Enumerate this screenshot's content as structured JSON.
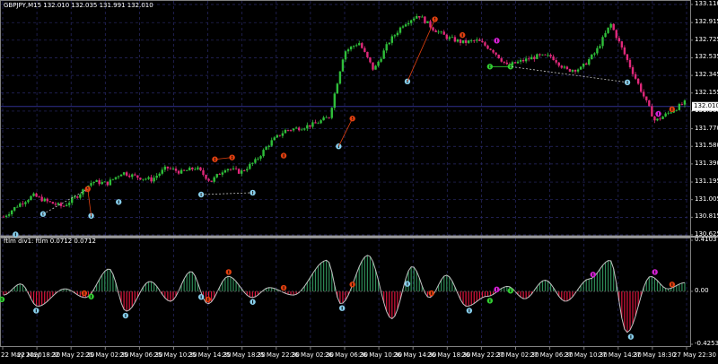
{
  "window": {
    "title": "GBPJPY,M15  132.010 132.035 131.991 132.010",
    "indicator_title": "ftlm div1: ftlm 0.0712 0.0712"
  },
  "colors": {
    "background": "#000000",
    "grid": "#2a2a6a",
    "candle_up": "#2fbf3a",
    "candle_down": "#e0287a",
    "candle_neutral": "#a0a0a0",
    "hist_up": "#2e8b57",
    "hist_down": "#dc143c",
    "osc_line": "#c0c0c0",
    "bid_line": "#303090",
    "arrow_down": "#e04010",
    "arrow_down_strong": "#d020d0",
    "arrow_up": "#87ceeb",
    "arrow_up_strong": "#32cd32",
    "div_line_bear": "#e04010",
    "div_line_bull": "#32cd32",
    "div_line_hidden": "#c0c0c0"
  },
  "chart_data": [
    {
      "type": "candlestick",
      "title": "GBPJPY,M15  132.010 132.035 131.991 132.010",
      "symbol": "GBPJPY",
      "timeframe": "M15",
      "last_price_label": "132.010",
      "ylim": [
        130.625,
        133.11
      ],
      "y_ticks": [
        "133.110",
        "132.915",
        "132.725",
        "132.535",
        "132.345",
        "132.155",
        "131.960",
        "131.770",
        "131.580",
        "131.390",
        "131.195",
        "131.005",
        "130.815",
        "130.625"
      ],
      "close_path": [
        130.82,
        130.95,
        131.05,
        130.98,
        130.93,
        131.05,
        131.2,
        131.18,
        131.3,
        131.25,
        131.22,
        131.35,
        131.3,
        131.35,
        131.2,
        131.35,
        131.3,
        131.42,
        131.62,
        131.75,
        131.78,
        131.82,
        131.9,
        132.6,
        132.7,
        132.4,
        132.7,
        132.9,
        133.0,
        132.85,
        132.75,
        132.7,
        132.72,
        132.62,
        132.45,
        132.5,
        132.55,
        132.55,
        132.4,
        132.42,
        132.6,
        132.9,
        132.55,
        132.2,
        131.85,
        131.95,
        132.05
      ],
      "price_cursor_level": 132.01,
      "signals": [
        {
          "kind": "up",
          "i": 0.02,
          "price": 130.63
        },
        {
          "kind": "up",
          "i": 0.06,
          "price": 130.85
        },
        {
          "kind": "down",
          "i": 0.125,
          "price": 131.12
        },
        {
          "kind": "up",
          "i": 0.13,
          "price": 130.83
        },
        {
          "kind": "up",
          "i": 0.17,
          "price": 130.98
        },
        {
          "kind": "up",
          "i": 0.29,
          "price": 131.06
        },
        {
          "kind": "down",
          "i": 0.31,
          "price": 131.44
        },
        {
          "kind": "down",
          "i": 0.335,
          "price": 131.46
        },
        {
          "kind": "up",
          "i": 0.365,
          "price": 131.08
        },
        {
          "kind": "down",
          "i": 0.41,
          "price": 131.48
        },
        {
          "kind": "down",
          "i": 0.51,
          "price": 131.88
        },
        {
          "kind": "up",
          "i": 0.49,
          "price": 131.58
        },
        {
          "kind": "up",
          "i": 0.59,
          "price": 132.28
        },
        {
          "kind": "down",
          "i": 0.63,
          "price": 132.95
        },
        {
          "kind": "down",
          "i": 0.67,
          "price": 132.78
        },
        {
          "kind": "strong_down",
          "i": 0.72,
          "price": 132.72
        },
        {
          "kind": "strong_up",
          "i": 0.71,
          "price": 132.44
        },
        {
          "kind": "strong_up",
          "i": 0.74,
          "price": 132.44
        },
        {
          "kind": "up",
          "i": 0.91,
          "price": 132.27
        },
        {
          "kind": "strong_down",
          "i": 0.955,
          "price": 131.93
        },
        {
          "kind": "down",
          "i": 0.975,
          "price": 131.98
        }
      ]
    },
    {
      "type": "histogram",
      "title": "ftlm div1: ftlm 0.0712 0.0712",
      "ylim": [
        -0.4253,
        0.4103
      ],
      "y_ticks": [
        "0.4103",
        "0.00",
        "-0.4253"
      ],
      "current_value": 0.0712,
      "wave": [
        {
          "i": 0.0,
          "v": -0.03
        },
        {
          "i": 0.025,
          "v": 0.06
        },
        {
          "i": 0.05,
          "v": -0.12
        },
        {
          "i": 0.09,
          "v": 0.02
        },
        {
          "i": 0.12,
          "v": -0.05
        },
        {
          "i": 0.155,
          "v": 0.18
        },
        {
          "i": 0.18,
          "v": -0.16
        },
        {
          "i": 0.215,
          "v": 0.08
        },
        {
          "i": 0.245,
          "v": -0.08
        },
        {
          "i": 0.275,
          "v": 0.16
        },
        {
          "i": 0.3,
          "v": -0.1
        },
        {
          "i": 0.33,
          "v": 0.12
        },
        {
          "i": 0.365,
          "v": -0.05
        },
        {
          "i": 0.39,
          "v": 0.03
        },
        {
          "i": 0.425,
          "v": -0.03
        },
        {
          "i": 0.475,
          "v": 0.25
        },
        {
          "i": 0.495,
          "v": -0.1
        },
        {
          "i": 0.535,
          "v": 0.29
        },
        {
          "i": 0.57,
          "v": -0.22
        },
        {
          "i": 0.6,
          "v": 0.2
        },
        {
          "i": 0.625,
          "v": -0.05
        },
        {
          "i": 0.65,
          "v": 0.13
        },
        {
          "i": 0.68,
          "v": -0.12
        },
        {
          "i": 0.71,
          "v": -0.04
        },
        {
          "i": 0.74,
          "v": 0.04
        },
        {
          "i": 0.765,
          "v": -0.06
        },
        {
          "i": 0.795,
          "v": 0.09
        },
        {
          "i": 0.825,
          "v": -0.08
        },
        {
          "i": 0.86,
          "v": 0.1
        },
        {
          "i": 0.89,
          "v": 0.25
        },
        {
          "i": 0.915,
          "v": -0.33
        },
        {
          "i": 0.95,
          "v": 0.12
        },
        {
          "i": 0.975,
          "v": 0.02
        },
        {
          "i": 1.0,
          "v": 0.07
        }
      ]
    }
  ],
  "x_axis": {
    "labels": [
      "22 May 2020",
      "22 May 18:30",
      "22 May 22:30",
      "25 May 02:30",
      "25 May 06:30",
      "25 May 10:30",
      "25 May 14:30",
      "25 May 18:30",
      "25 May 22:30",
      "26 May 02:30",
      "26 May 06:30",
      "26 May 10:30",
      "26 May 14:30",
      "26 May 18:30",
      "26 May 22:30",
      "27 May 02:30",
      "27 May 06:30",
      "27 May 10:30",
      "27 May 14:30",
      "27 May 18:30",
      "27 May 22:30"
    ]
  }
}
